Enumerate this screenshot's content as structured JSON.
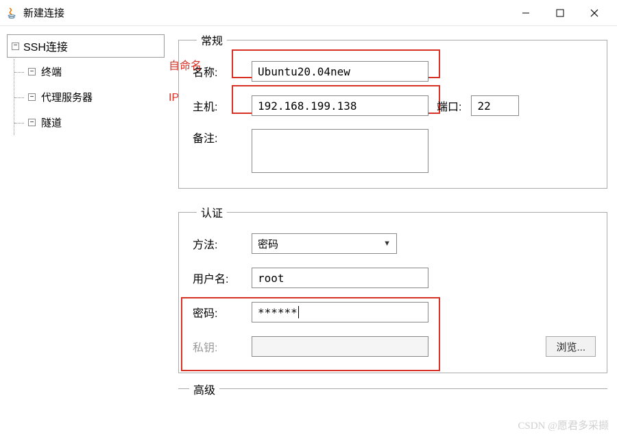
{
  "window": {
    "title": "新建连接"
  },
  "sidebar": {
    "root": "SSH连接",
    "items": [
      "终端",
      "代理服务器",
      "隧道"
    ]
  },
  "annotations": {
    "name_hint": "自命名",
    "host_hint": "IP"
  },
  "general": {
    "legend": "常规",
    "name_label": "名称:",
    "name_value": "Ubuntu20.04new",
    "host_label": "主机:",
    "host_value": "192.168.199.138",
    "port_label": "端口:",
    "port_value": "22",
    "remark_label": "备注:",
    "remark_value": ""
  },
  "auth": {
    "legend": "认证",
    "method_label": "方法:",
    "method_value": "密码",
    "username_label": "用户名:",
    "username_value": "root",
    "password_label": "密码:",
    "password_value": "******",
    "privatekey_label": "私钥:",
    "privatekey_value": "",
    "browse_label": "浏览..."
  },
  "advanced": {
    "legend": "高级"
  },
  "watermark": "CSDN @愿君多采撷"
}
